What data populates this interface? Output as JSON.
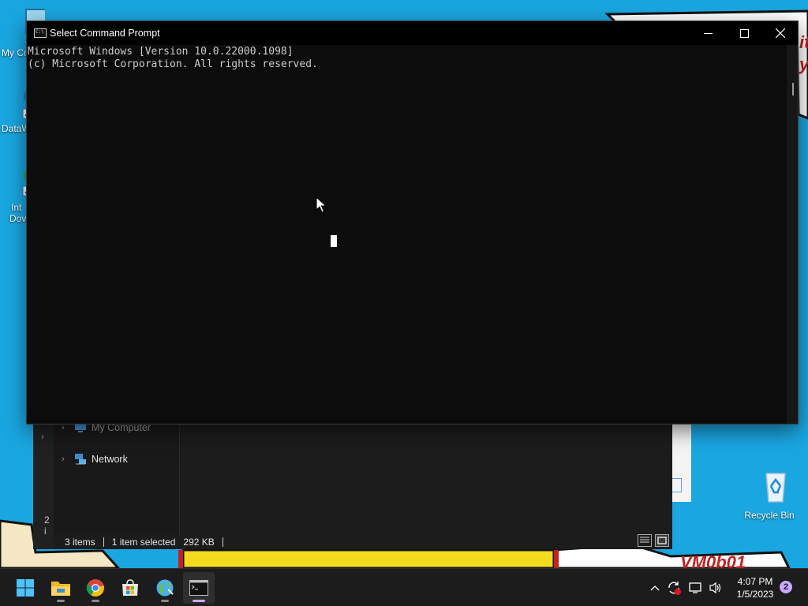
{
  "desktop": {
    "icons": [
      {
        "label": "My Co"
      },
      {
        "label": "DataW"
      },
      {
        "label_line1": "Int",
        "label_line2": "Dov"
      },
      {
        "label": "Recycle Bin"
      }
    ],
    "wallpaper_text_right_1": "it",
    "wallpaper_text_right_2": "y",
    "wallpaper_text_bottom": "VM0b01"
  },
  "explorer": {
    "nav_items": [
      {
        "label": "My Computer"
      },
      {
        "label": "Network"
      }
    ],
    "side_count": "2 i",
    "status": {
      "items": "3 items",
      "selected": "1 item selected",
      "size": "292 KB"
    }
  },
  "cmd": {
    "title": "Select Command Prompt",
    "lines": [
      "Microsoft Windows [Version 10.0.22000.1098]",
      "(c) Microsoft Corporation. All rights reserved."
    ]
  },
  "taskbar": {
    "apps": [
      "start-icon",
      "file-explorer-icon",
      "chrome-icon",
      "store-icon",
      "globe-app-icon",
      "terminal-icon"
    ],
    "clock": {
      "time": "4:07 PM",
      "date": "1/5/2023"
    },
    "notification_count": "2"
  },
  "colors": {
    "wallpaper": "#1aa6e0",
    "cmd_bg": "#0c0c0c",
    "taskbar_bg": "#1c1c1c",
    "accent": "#c9a8ff"
  }
}
